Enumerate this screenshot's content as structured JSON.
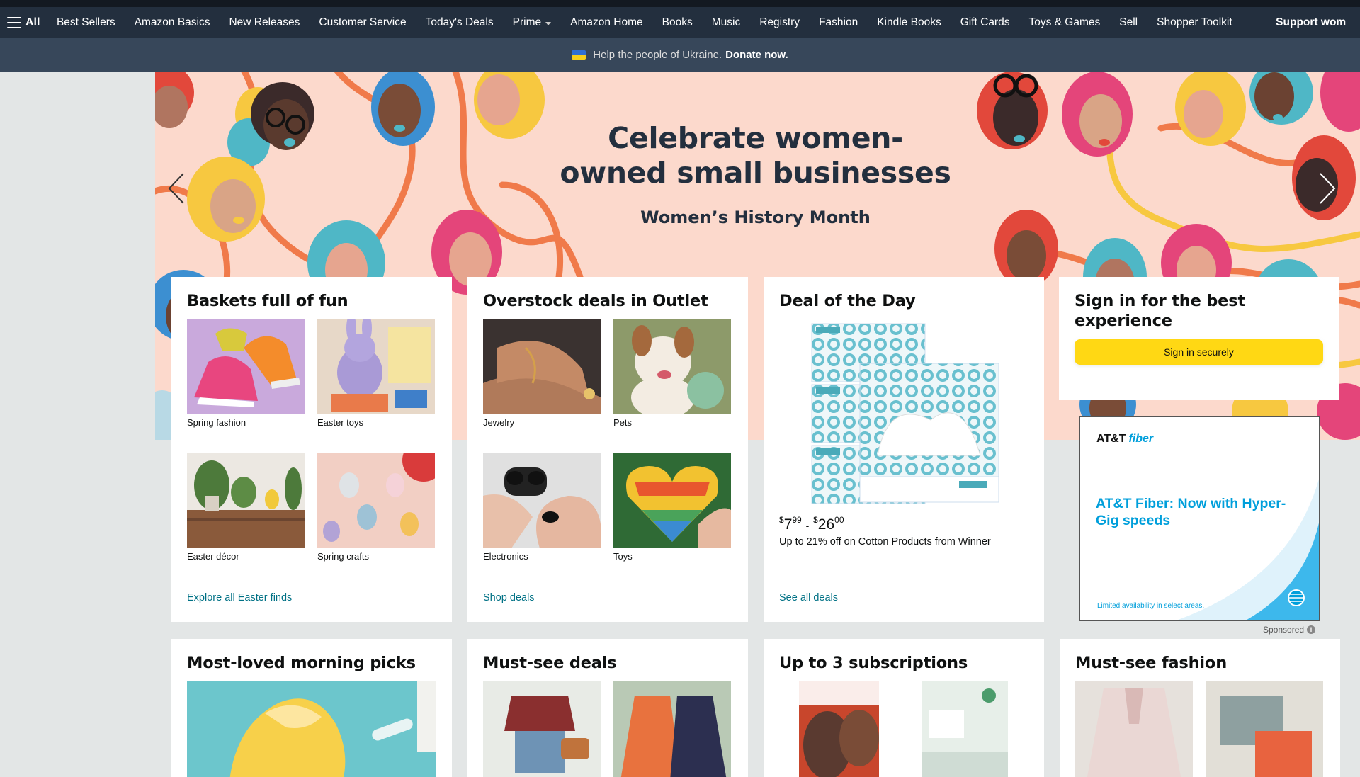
{
  "nav": {
    "all_label": "All",
    "items": [
      "Best Sellers",
      "Amazon Basics",
      "New Releases",
      "Customer Service",
      "Today's Deals",
      "Prime",
      "Amazon Home",
      "Books",
      "Music",
      "Registry",
      "Fashion",
      "Kindle Books",
      "Gift Cards",
      "Toys & Games",
      "Sell",
      "Shopper Toolkit"
    ],
    "promo": "Support wom"
  },
  "ukraine": {
    "text": "Help the people of Ukraine.",
    "link": "Donate now."
  },
  "hero": {
    "title": "Celebrate women-owned small businesses",
    "subtitle": "Women’s History Month"
  },
  "cards": {
    "baskets": {
      "title": "Baskets full of fun",
      "tiles": [
        "Spring fashion",
        "Easter toys",
        "Easter décor",
        "Spring crafts"
      ],
      "link": "Explore all Easter finds"
    },
    "outlet": {
      "title": "Overstock deals in Outlet",
      "tiles": [
        "Jewelry",
        "Pets",
        "Electronics",
        "Toys"
      ],
      "link": "Shop deals"
    },
    "deal": {
      "title": "Deal of the Day",
      "price_low_whole": "7",
      "price_low_frac": "99",
      "price_high_whole": "26",
      "price_high_frac": "00",
      "currency": "$",
      "description": "Up to 21% off on Cotton Products from Winner",
      "link": "See all deals"
    }
  },
  "signin": {
    "title": "Sign in for the best experience",
    "button": "Sign in securely"
  },
  "ad": {
    "brand": "AT&T",
    "brand_suffix": "fiber",
    "headline": "AT&T Fiber: Now with Hyper-Gig speeds",
    "fine_print": "Limited availability in select areas.",
    "sponsored": "Sponsored"
  },
  "bottom": {
    "morning": "Most-loved morning picks",
    "mustsee": "Must-see deals",
    "subscriptions": "Up to 3 subscriptions",
    "fashion": "Must-see fashion"
  },
  "colors": {
    "nav_bg": "#232f3e",
    "sub_bg": "#37475a",
    "hero_bg": "#fcd9cc",
    "link": "#007185",
    "signin_btn": "#ffd814",
    "att_blue": "#009fdb"
  }
}
